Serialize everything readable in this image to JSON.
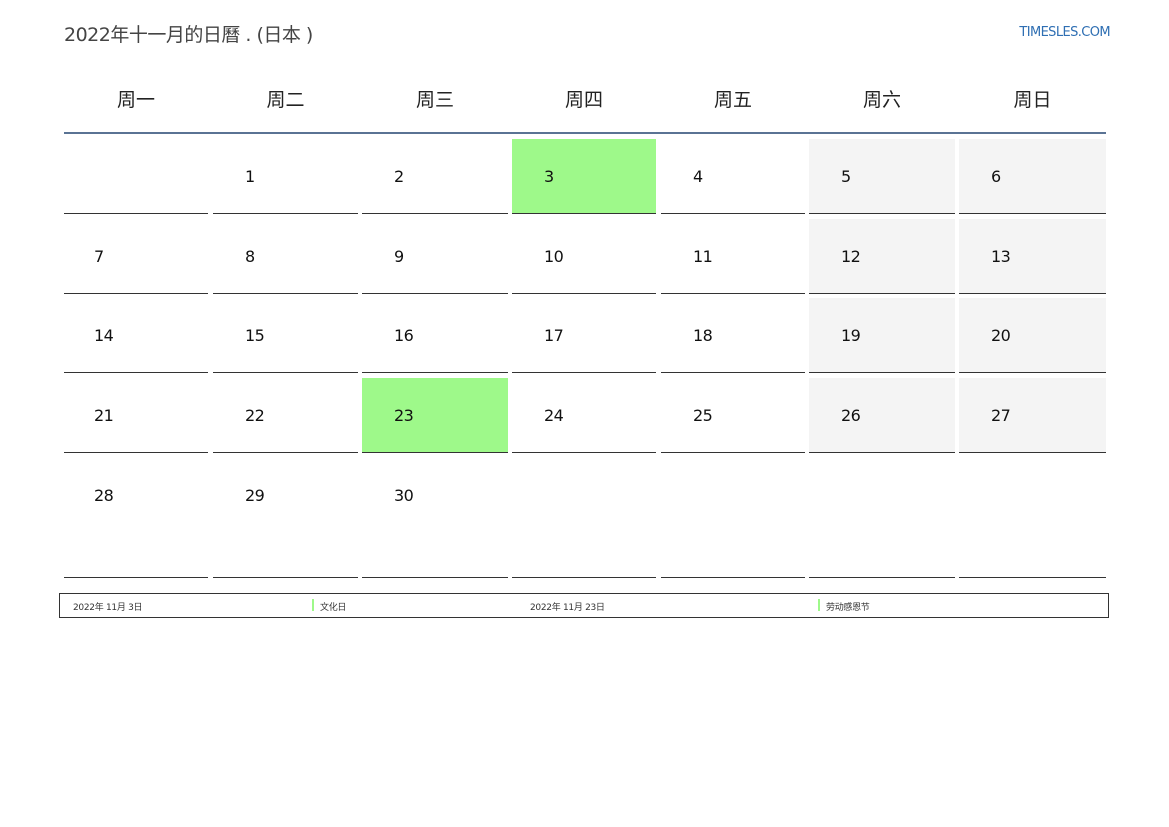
{
  "header": {
    "title": "2022年十一月的日曆 . (日本 )",
    "site": "TIMESLES.COM"
  },
  "weekdays": [
    "周一",
    "周二",
    "周三",
    "周四",
    "周五",
    "周六",
    "周日"
  ],
  "weeks": [
    [
      "",
      "1",
      "2",
      "3",
      "4",
      "5",
      "6"
    ],
    [
      "7",
      "8",
      "9",
      "10",
      "11",
      "12",
      "13"
    ],
    [
      "14",
      "15",
      "16",
      "17",
      "18",
      "19",
      "20"
    ],
    [
      "21",
      "22",
      "23",
      "24",
      "25",
      "26",
      "27"
    ],
    [
      "28",
      "29",
      "30",
      "",
      "",
      "",
      ""
    ]
  ],
  "holidays": [
    {
      "date": "2022年 11月 3日",
      "day": "3",
      "name": "文化日"
    },
    {
      "date": "2022年 11月 23日",
      "day": "23",
      "name": "劳动感恩节"
    }
  ],
  "colors": {
    "holiday": "#9ef98a",
    "weekend": "#f4f4f4",
    "header_rule": "#5a7394",
    "link": "#2f6fb3"
  }
}
